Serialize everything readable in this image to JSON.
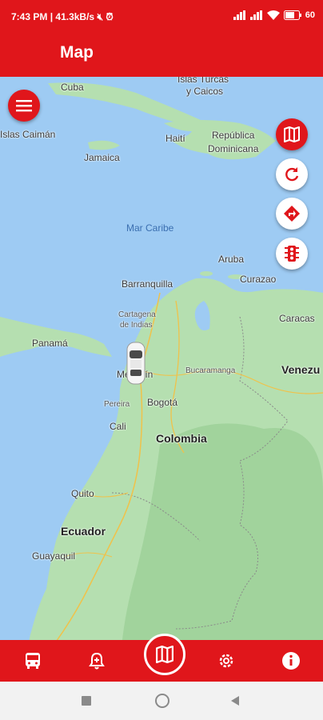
{
  "status_bar": {
    "time": "7:43 PM",
    "speed": "41.3kB/s",
    "battery": "60"
  },
  "app_bar": {
    "title": "Map"
  },
  "map": {
    "labels": {
      "cuba": "Cuba",
      "turks": "Islas Turcas",
      "caicos": "y Caicos",
      "cayman": "Islas Caimán",
      "jamaica": "Jamaica",
      "haiti": "Haití",
      "dominican1": "República",
      "dominican2": "Dominicana",
      "caribbean_sea": "Mar Caribe",
      "aruba": "Aruba",
      "curacao": "Curazao",
      "barranquilla": "Barranquilla",
      "cartagena1": "Cartagena",
      "cartagena2": "de Indias",
      "caracas": "Caracas",
      "panama": "Panamá",
      "medellin": "Medellín",
      "bucaramanga": "Bucaramanga",
      "venezuela": "Venezu",
      "pereira": "Pereira",
      "bogota": "Bogotá",
      "cali": "Cali",
      "colombia": "Colombia",
      "quito": "Quito",
      "ecuador": "Ecuador",
      "guayaquil": "Guayaquil"
    },
    "fab_icons": [
      "map-icon",
      "refresh-icon",
      "directions-icon",
      "traffic-light-icon"
    ]
  },
  "bottom_nav": {
    "items": [
      "bus-icon",
      "alarm-icon",
      "map-icon",
      "settings-icon",
      "info-icon"
    ]
  },
  "colors": {
    "brand": "#e0161b",
    "water": "#9ecbf3",
    "land": "#b5dfb0"
  }
}
